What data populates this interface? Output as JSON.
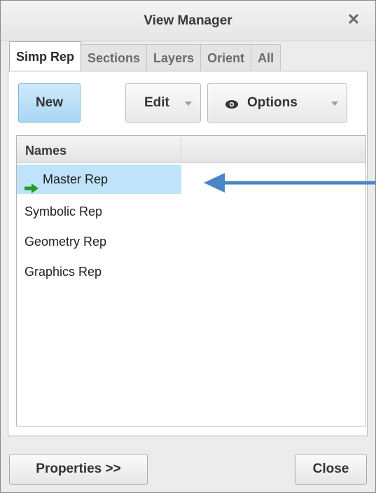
{
  "window": {
    "title": "View Manager",
    "close_glyph": "✕"
  },
  "tabs": [
    {
      "label": "Simp Rep",
      "active": true
    },
    {
      "label": "Sections",
      "active": false
    },
    {
      "label": "Layers",
      "active": false
    },
    {
      "label": "Orient",
      "active": false
    },
    {
      "label": "All",
      "active": false
    }
  ],
  "toolbar": {
    "new_label": "New",
    "edit_label": "Edit",
    "options_label": "Options",
    "options_icon": "eye-icon",
    "dropdown_icon": "caret-down-icon"
  },
  "list": {
    "column_header": "Names",
    "rows": [
      {
        "label": "Master Rep",
        "selected": true,
        "active_icon": "green-arrow-right-icon"
      },
      {
        "label": "Symbolic Rep",
        "selected": false
      },
      {
        "label": "Geometry Rep",
        "selected": false
      },
      {
        "label": "Graphics Rep",
        "selected": false
      }
    ]
  },
  "footer": {
    "properties_label": "Properties >>",
    "close_label": "Close"
  },
  "colors": {
    "selection": "#bfe4fa",
    "new_button": "#a9d6f5",
    "annotation_arrow": "#4a86c6",
    "active_arrow": "#1f9e1f"
  }
}
